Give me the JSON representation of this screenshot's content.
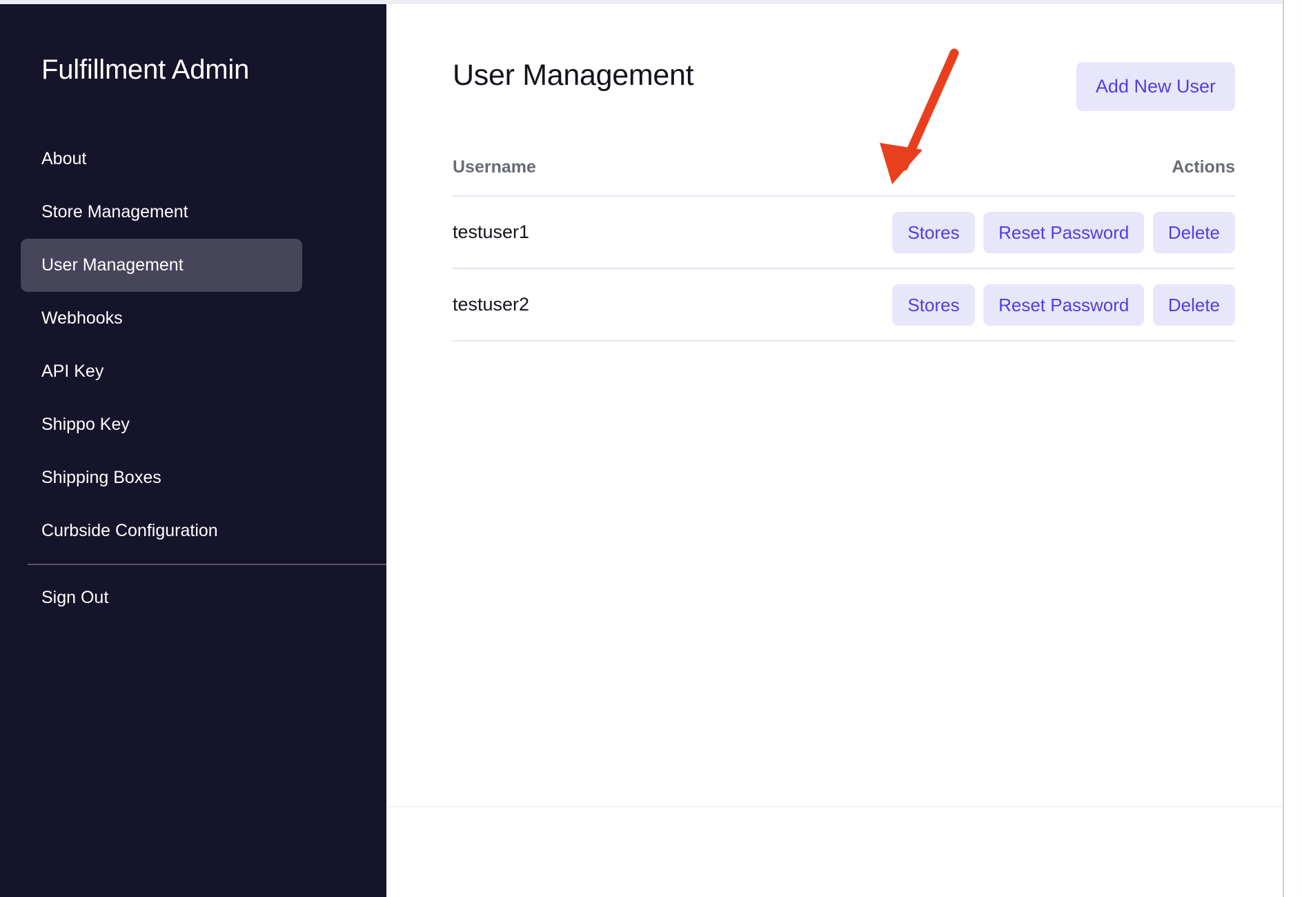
{
  "sidebar": {
    "brand": "Fulfillment Admin",
    "items": [
      {
        "label": "About",
        "active": false
      },
      {
        "label": "Store Management",
        "active": false
      },
      {
        "label": "User Management",
        "active": true
      },
      {
        "label": "Webhooks",
        "active": false
      },
      {
        "label": "API Key",
        "active": false
      },
      {
        "label": "Shippo Key",
        "active": false
      },
      {
        "label": "Shipping Boxes",
        "active": false
      },
      {
        "label": "Curbside Configuration",
        "active": false
      }
    ],
    "sign_out_label": "Sign Out"
  },
  "main": {
    "page_title": "User Management",
    "add_user_label": "Add New User",
    "table": {
      "headers": [
        "Username",
        "Actions"
      ],
      "rows": [
        {
          "username": "testuser1",
          "actions": [
            "Stores",
            "Reset Password",
            "Delete"
          ]
        },
        {
          "username": "testuser2",
          "actions": [
            "Stores",
            "Reset Password",
            "Delete"
          ]
        }
      ]
    }
  },
  "annotation": {
    "type": "arrow",
    "color": "#e8401f",
    "points_to": "Stores button on testuser1 row"
  },
  "colors": {
    "sidebar_bg": "#15142a",
    "sidebar_active_bg": "#474559",
    "accent_button_bg": "#e8e6fb",
    "accent_button_text": "#4f3fe0",
    "table_border": "#e6e4f4",
    "header_text": "#666b74",
    "annotation_red": "#e8401f"
  }
}
